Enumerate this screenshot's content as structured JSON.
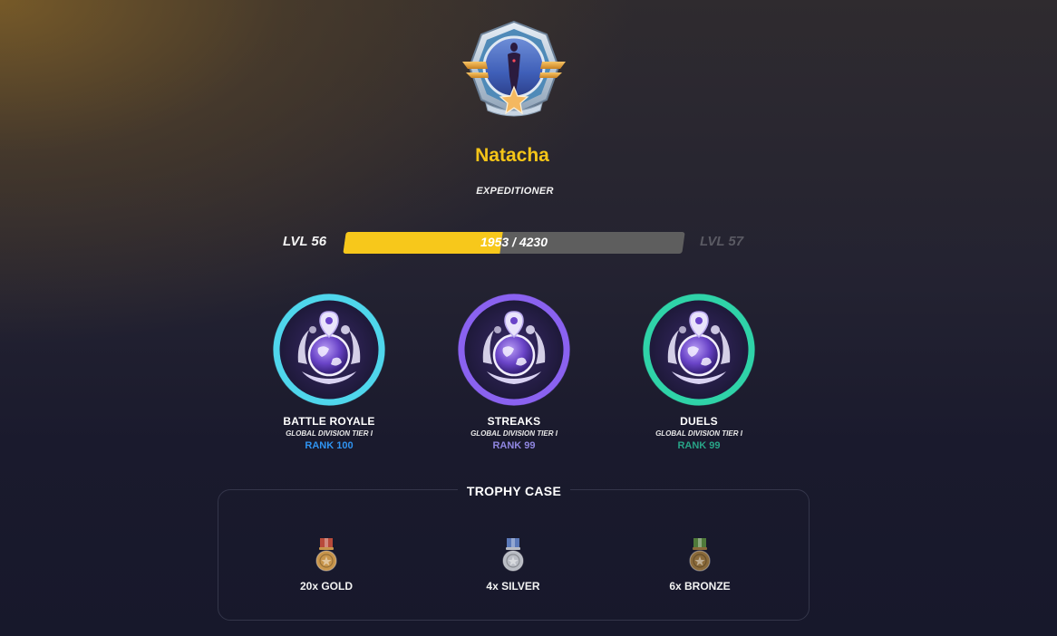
{
  "player": {
    "name": "Natacha",
    "title": "EXPEDITIONER"
  },
  "level": {
    "current_label": "LVL 56",
    "next_label": "LVL 57",
    "xp_text": "1953 / 4230",
    "progress_fraction": 0.4617
  },
  "ranks": [
    {
      "mode": "BATTLE ROYALE",
      "division": "GLOBAL DIVISION TIER I",
      "rank": "RANK 100",
      "color": "#4fd6ec",
      "rank_color": "#2f93f0"
    },
    {
      "mode": "STREAKS",
      "division": "GLOBAL DIVISION TIER I",
      "rank": "RANK 99",
      "color": "#8a62f0",
      "rank_color": "#8f86e0"
    },
    {
      "mode": "DUELS",
      "division": "GLOBAL DIVISION TIER I",
      "rank": "RANK 99",
      "color": "#2fd3a8",
      "rank_color": "#28a487"
    }
  ],
  "trophy_case": {
    "title": "TROPHY CASE",
    "medals": [
      {
        "label": "20x GOLD",
        "icon": "gold-medal-icon",
        "color": "#c8954b",
        "ribbon": "#b84a3a"
      },
      {
        "label": "4x SILVER",
        "icon": "silver-medal-icon",
        "color": "#b9bcc4",
        "ribbon": "#5a78b8"
      },
      {
        "label": "6x BRONZE",
        "icon": "bronze-medal-icon",
        "color": "#8a6a3a",
        "ribbon": "#4f7a3a"
      }
    ]
  },
  "colors": {
    "accent_yellow": "#f5c518",
    "xp_fill": "#f7c81b",
    "xp_track": "#5e5e5e"
  }
}
